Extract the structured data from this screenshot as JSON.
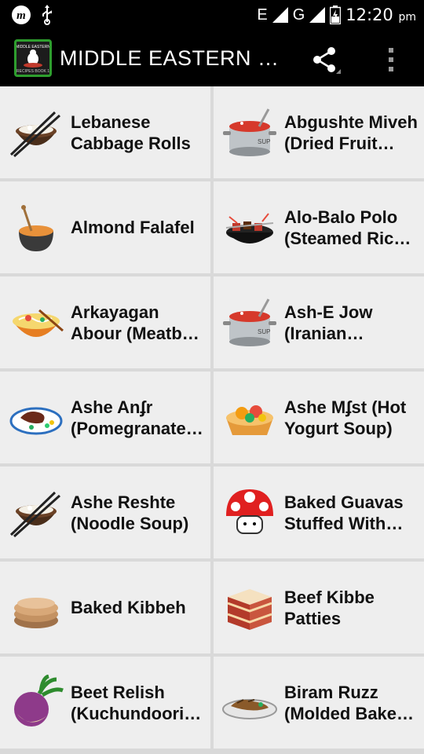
{
  "status_bar": {
    "time": "12:20",
    "ampm": "pm",
    "network_label": "E",
    "network_label_2": "G",
    "left_icons": [
      "m-logo-icon",
      "usb-icon"
    ]
  },
  "app_bar": {
    "title": "MIDDLE EASTERN RE...",
    "logo_text_1": "MIDDLE EASTERN",
    "logo_text_2": "RECIPES BOOK 1"
  },
  "recipes": [
    {
      "label": "Lebanese Cabbage Rolls",
      "icon": "rice-bowl-chopsticks-icon"
    },
    {
      "label": "Abgushte Miveh (Dried Fruit…",
      "icon": "soup-pot-icon"
    },
    {
      "label": "Almond Falafel",
      "icon": "cooking-pot-icon"
    },
    {
      "label": "Alo-Balo Polo (Steamed Ric…",
      "icon": "skewer-wok-icon"
    },
    {
      "label": "Arkayagan Abour (Meatb…",
      "icon": "noodle-bowl-icon"
    },
    {
      "label": "Ash-E Jow (Iranian Barley…",
      "icon": "soup-pot-icon"
    },
    {
      "label": "Ashe Anʄr (Pomegranate…",
      "icon": "steak-plate-icon"
    },
    {
      "label": "Ashe Mʄst (Hot Yogurt Soup)",
      "icon": "fruit-tart-icon"
    },
    {
      "label": "Ashe Reshte (Noodle Soup)",
      "icon": "rice-bowl-chopsticks-icon"
    },
    {
      "label": "Baked Guavas Stuffed With…",
      "icon": "mushroom-icon"
    },
    {
      "label": "Baked Kibbeh",
      "icon": "pancake-stack-icon"
    },
    {
      "label": "Beef Kibbe Patties",
      "icon": "layer-cake-icon"
    },
    {
      "label": "Beet Relish (Kuchundoori…",
      "icon": "turnip-icon"
    },
    {
      "label": "Biram Ruzz (Molded Bake…",
      "icon": "meat-platter-icon"
    }
  ]
}
